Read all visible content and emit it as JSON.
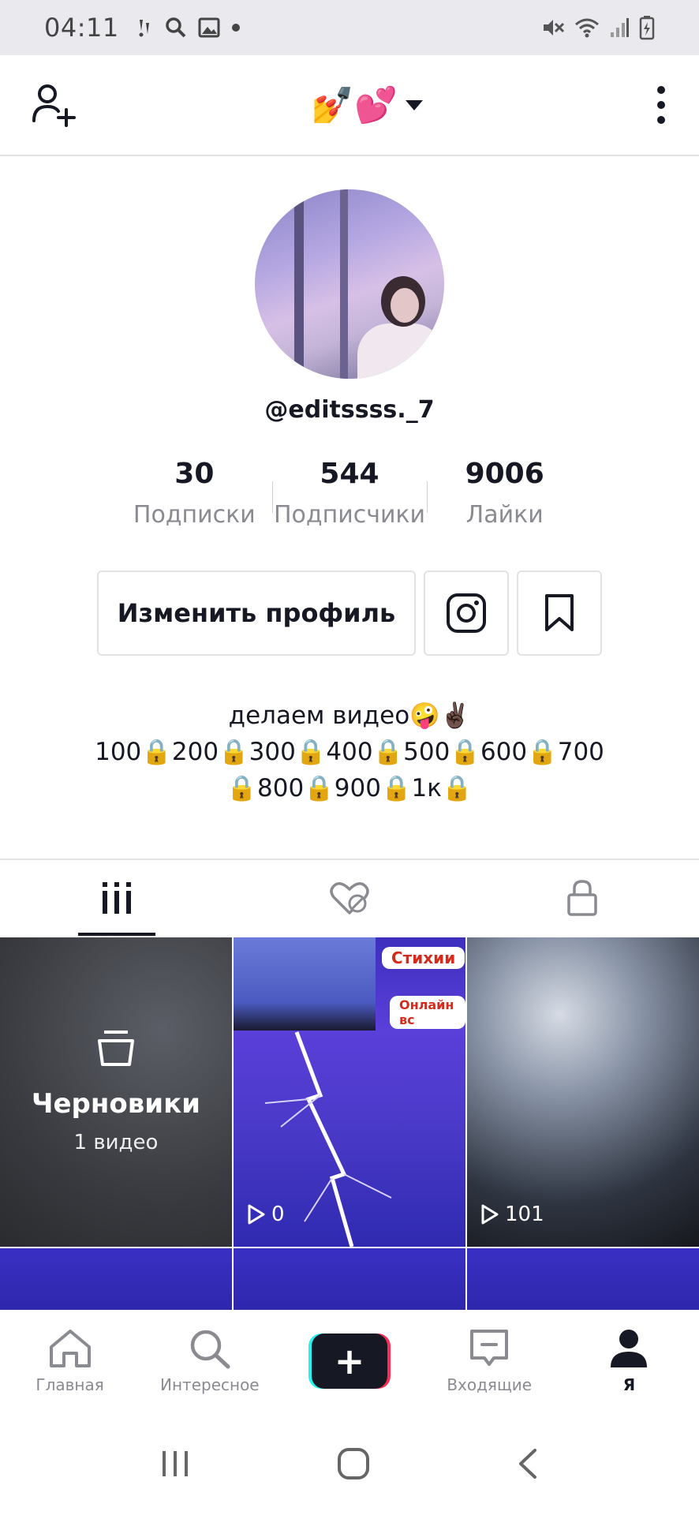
{
  "status_bar": {
    "time": "04:11"
  },
  "top_bar": {
    "username_display": "💅💕"
  },
  "profile": {
    "handle": "@editssss._7",
    "stats": [
      {
        "value": "30",
        "label": "Подписки"
      },
      {
        "value": "544",
        "label": "Подписчики"
      },
      {
        "value": "9006",
        "label": "Лайки"
      }
    ],
    "edit_button": "Изменить профиль",
    "bio_lines": [
      "делаем видео🤪✌🏿",
      "100🔒200🔒300🔒400🔒500🔒600🔒700",
      "🔒800🔒900🔒1к🔒"
    ]
  },
  "grid": {
    "drafts_title": "Черновики",
    "drafts_count": "1 видео",
    "videos": [
      {
        "views": "0",
        "tags": [
          "Стихии",
          "Онлайн вс"
        ]
      },
      {
        "views": "101"
      }
    ]
  },
  "bottom_nav": {
    "items": [
      {
        "label": "Главная",
        "icon": "home-icon"
      },
      {
        "label": "Интересное",
        "icon": "search-icon"
      },
      {
        "label": "",
        "icon": "plus-icon"
      },
      {
        "label": "Входящие",
        "icon": "inbox-icon"
      },
      {
        "label": "Я",
        "icon": "person-icon"
      }
    ]
  },
  "colors": {
    "text": "#161823",
    "muted": "#8a8b91",
    "border": "#e3e3e4",
    "cyan": "#25f4ee",
    "pink": "#fe2c55"
  }
}
